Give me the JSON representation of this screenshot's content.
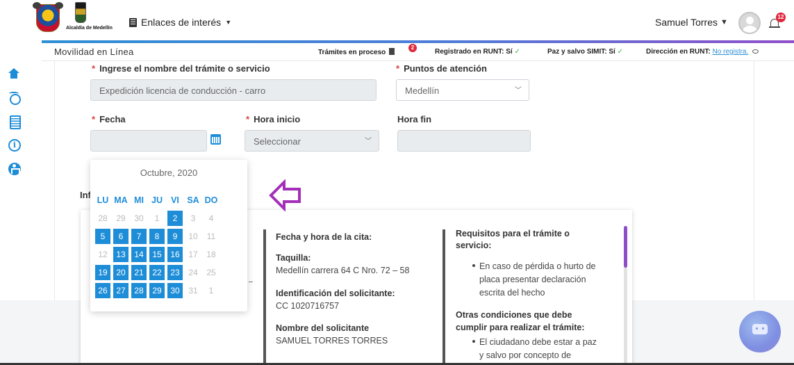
{
  "header": {
    "logo_text": "Alcaldía de Medellín",
    "links_menu_label": "Enlaces de interés",
    "user_name": "Samuel Torres",
    "notification_count": "12"
  },
  "subheader": {
    "title": "Movilidad en Línea",
    "tramites_label": "Trámites en proceso",
    "tramites_count": "2",
    "runt_label": "Registrado en RUNT:",
    "runt_value": "Sí",
    "simit_label": "Paz y salvo SIMIT:",
    "simit_value": "Sí",
    "direccion_label": "Dirección en RUNT:",
    "direccion_value": "No registra."
  },
  "sidebar": {
    "items": [
      "home-icon",
      "radar-icon",
      "list-icon",
      "info-icon",
      "accessibility-icon"
    ]
  },
  "form": {
    "tramite_label": "Ingrese el nombre del trámite o servicio",
    "tramite_value": "Expedición licencia de conducción - carro",
    "puntos_label": "Puntos de atención",
    "puntos_value": "Medellín",
    "fecha_label": "Fecha",
    "hora_inicio_label": "Hora inicio",
    "hora_inicio_value": "Seleccionar",
    "hora_fin_label": "Hora fin",
    "info_label_partial": "Inf"
  },
  "calendar": {
    "month": "Octubre,",
    "year": "2020",
    "weekdays": [
      "LU",
      "MA",
      "MI",
      "JU",
      "VI",
      "SA",
      "DO"
    ],
    "weeks": [
      [
        {
          "d": "28",
          "s": "muted"
        },
        {
          "d": "29",
          "s": "muted"
        },
        {
          "d": "30",
          "s": "muted"
        },
        {
          "d": "1",
          "s": "muted"
        },
        {
          "d": "2",
          "s": "active"
        },
        {
          "d": "3",
          "s": "muted"
        },
        {
          "d": "4",
          "s": "muted"
        }
      ],
      [
        {
          "d": "5",
          "s": "active"
        },
        {
          "d": "6",
          "s": "active"
        },
        {
          "d": "7",
          "s": "active"
        },
        {
          "d": "8",
          "s": "active"
        },
        {
          "d": "9",
          "s": "active"
        },
        {
          "d": "10",
          "s": "muted"
        },
        {
          "d": "11",
          "s": "muted"
        }
      ],
      [
        {
          "d": "12",
          "s": "muted"
        },
        {
          "d": "13",
          "s": "active"
        },
        {
          "d": "14",
          "s": "active"
        },
        {
          "d": "15",
          "s": "active"
        },
        {
          "d": "16",
          "s": "active"
        },
        {
          "d": "17",
          "s": "muted"
        },
        {
          "d": "18",
          "s": "muted"
        }
      ],
      [
        {
          "d": "19",
          "s": "active"
        },
        {
          "d": "20",
          "s": "active"
        },
        {
          "d": "21",
          "s": "active"
        },
        {
          "d": "22",
          "s": "active"
        },
        {
          "d": "23",
          "s": "active"
        },
        {
          "d": "24",
          "s": "muted"
        },
        {
          "d": "25",
          "s": "muted"
        }
      ],
      [
        {
          "d": "26",
          "s": "active"
        },
        {
          "d": "27",
          "s": "active"
        },
        {
          "d": "28",
          "s": "active"
        },
        {
          "d": "29",
          "s": "active"
        },
        {
          "d": "30",
          "s": "active"
        },
        {
          "d": "31",
          "s": "muted"
        },
        {
          "d": "1",
          "s": "muted"
        }
      ]
    ]
  },
  "ticket": {
    "fecha_hora_label": "Fecha y hora de la cita:",
    "taquilla_label": "Taquilla:",
    "taquilla_value": "Medellín carrera 64 C Nro. 72 – 58",
    "identificacion_label": "Identificación del solicitante:",
    "identificacion_value": "CC 1020716757",
    "nombre_label": "Nombre del solicitante",
    "nombre_value": "SAMUEL TORRES TORRES",
    "requisitos_title_1": "Requisitos para el trámite o",
    "requisitos_title_2": "servicio:",
    "requisito_1_l1": "En caso de pérdida o hurto de",
    "requisito_1_l2": "placa presentar declaración",
    "requisito_1_l3": "escrita del hecho",
    "otras_title_1": "Otras condiciones que debe",
    "otras_title_2": "cumplir para realizar el trámite:",
    "otra_1_l1": "El ciudadano debe estar a paz",
    "otra_1_l2": "y salvo por concepto de"
  },
  "colors": {
    "accent": "#1e8dd8",
    "highlight_arrow": "#a32fb8",
    "required": "#e04040",
    "check": "#3bb54a"
  }
}
